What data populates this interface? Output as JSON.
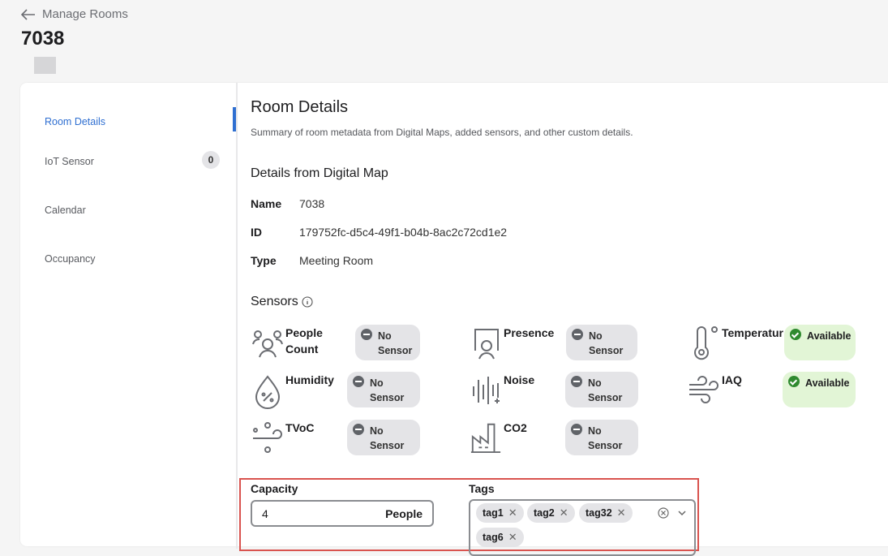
{
  "header": {
    "back_label": "Manage Rooms",
    "title": "7038"
  },
  "sidebar": {
    "items": [
      {
        "label": "Room Details",
        "active": true
      },
      {
        "label": "IoT Sensor",
        "badge": "0"
      },
      {
        "label": "Calendar"
      },
      {
        "label": "Occupancy"
      }
    ]
  },
  "main": {
    "title": "Room Details",
    "subtitle": "Summary of room metadata from Digital Maps, added sensors, and other custom details.",
    "digital_map": {
      "heading": "Details from Digital Map",
      "fields": [
        {
          "key": "Name",
          "value": "7038"
        },
        {
          "key": "ID",
          "value": "179752fc-d5c4-49f1-b04b-8ac2c72cd1e2"
        },
        {
          "key": "Type",
          "value": "Meeting Room"
        }
      ]
    },
    "sensors": {
      "heading": "Sensors",
      "items": [
        {
          "label": "People Count",
          "status": "No Sensor"
        },
        {
          "label": "Presence",
          "status": "No Sensor"
        },
        {
          "label": "Temperatur",
          "status": "Available"
        },
        {
          "label": "Humidity",
          "status": "No Sensor"
        },
        {
          "label": "Noise",
          "status": "No Sensor"
        },
        {
          "label": "IAQ",
          "status": "Available"
        },
        {
          "label": "TVoC",
          "status": "No Sensor"
        },
        {
          "label": "CO2",
          "status": "No Sensor"
        }
      ]
    },
    "capacity": {
      "label": "Capacity",
      "value": "4",
      "unit": "People"
    },
    "tags": {
      "label": "Tags",
      "items": [
        "tag1",
        "tag2",
        "tag32",
        "tag6"
      ]
    }
  },
  "colors": {
    "accent": "#2f6fd1",
    "available_bg": "#e2f5d6",
    "highlight": "#d9534f"
  }
}
